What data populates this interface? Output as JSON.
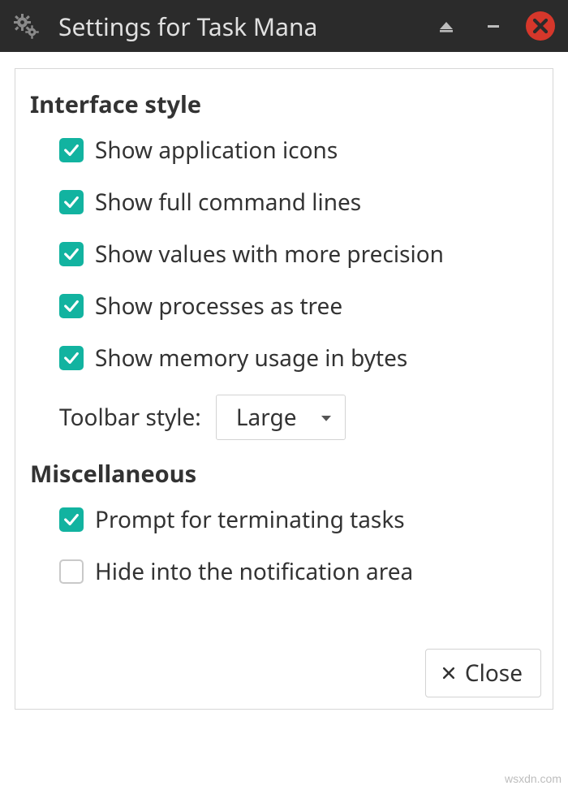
{
  "window": {
    "title": "Settings for Task Mana"
  },
  "sections": {
    "interface": {
      "title": "Interface style",
      "options": {
        "show_icons": {
          "label": "Show application icons",
          "checked": true
        },
        "show_cmd": {
          "label": "Show full command lines",
          "checked": true
        },
        "show_prec": {
          "label": "Show values with more precision",
          "checked": true
        },
        "show_tree": {
          "label": "Show processes as tree",
          "checked": true
        },
        "show_mem": {
          "label": "Show memory usage in bytes",
          "checked": true
        }
      },
      "toolbar": {
        "label": "Toolbar style:",
        "value": "Large"
      }
    },
    "misc": {
      "title": "Miscellaneous",
      "options": {
        "prompt_term": {
          "label": "Prompt for terminating tasks",
          "checked": true
        },
        "hide_notif": {
          "label": "Hide into the notification area",
          "checked": false
        }
      }
    }
  },
  "footer": {
    "close_label": "Close"
  },
  "watermark": "wsxdn.com"
}
